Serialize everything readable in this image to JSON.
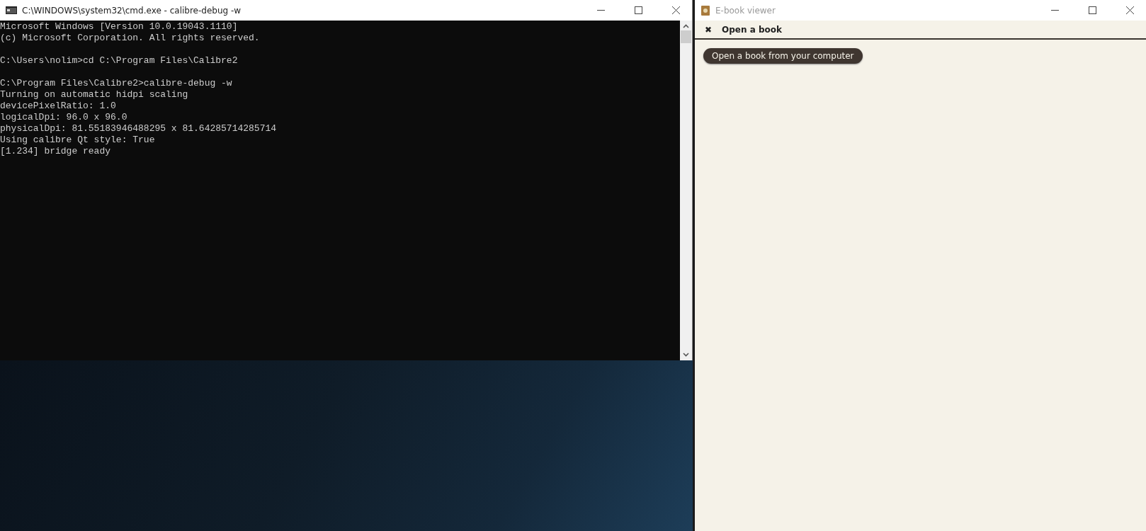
{
  "console_window": {
    "title": "C:\\WINDOWS\\system32\\cmd.exe - calibre-debug  -w",
    "blocks": [
      [
        "Microsoft Windows [Version 10.0.19043.1110]",
        "(c) Microsoft Corporation. All rights reserved."
      ],
      [
        "C:\\Users\\nolim>cd C:\\Program Files\\Calibre2"
      ],
      [
        "C:\\Program Files\\Calibre2>calibre-debug -w",
        "Turning on automatic hidpi scaling",
        "devicePixelRatio: 1.0",
        "logicalDpi: 96.0 x 96.0",
        "physicalDpi: 81.55183946488295 x 81.64285714285714",
        "Using calibre Qt style: True",
        "[1.234] bridge ready"
      ]
    ]
  },
  "viewer_window": {
    "title": "E-book viewer",
    "header": {
      "close_glyph": "✖",
      "title": "Open a book"
    },
    "open_button": "Open a book from your computer"
  }
}
